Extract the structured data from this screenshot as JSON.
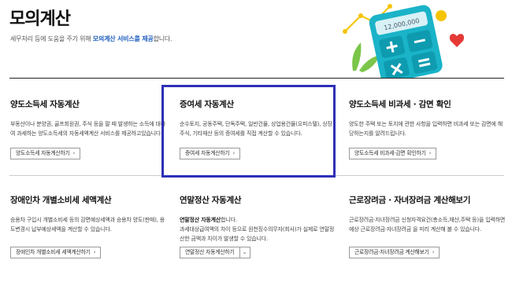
{
  "header": {
    "title": "모의계산",
    "subtitle_prefix": "세무처리 등에 도움을 주기 위해 ",
    "subtitle_highlight": "모의계산 서비스를 제공",
    "subtitle_suffix": "합니다.",
    "illustration_display": "12,000,000"
  },
  "cards": [
    {
      "title": "양도소득세 자동계산",
      "desc": "부동산이나 분양권, 골프회원권, 주식 등을 팔 때 발생하는 소득에 대하여 과세하는 양도소득세의 자동세액계산 서비스를 제공하고있습니다.",
      "button": "양도소득세 자동계산하기"
    },
    {
      "title": "증여세 자동계산",
      "desc": "순수토지, 공동주택, 단독주택, 일반건물, 상업용건물(오피스텔), 상장주식, 기타재산 등의 증여세를 직접 계산할 수 있습니다.",
      "button": "증여세 자동계산하기"
    },
    {
      "title": "양도소득세 비과세 · 감면 확인",
      "desc": "양도한 주택 또는 토지에 관한 사항을 입력하면 비과세 또는 감면에 해당하는지를 알려드립니다.",
      "button": "양도소득세 비과세·감면 확인하기"
    },
    {
      "title": "장애인차 개별소비세 세액계산",
      "desc": "승용차 구입시 개별소비세 등의 감면예상세액과 승용차 양도(판매), 용도변경시 납부예상세액을 계산할 수 있습니다.",
      "button": "장애인차 개별소비세 세액계산하기"
    },
    {
      "title": "연말정산 자동계산",
      "desc_strong": "연말정산 자동계산",
      "desc_rest": "합니다.",
      "desc2": "과세대상급여액의 차이 등으로 원천징수의무자(회사)가 실제로 연말정산한 금액과 차이가 발생할 수 있습니다.",
      "select": "연말정산 자동계산하기"
    },
    {
      "title": "근로장려금 · 자녀장려금 계산해보기",
      "desc": "근로장려금·자녀장려금 신청자격요건(총소득,재산,주택 등)을 입력하면 예상 근로장려금·자녀장려금 을 미리 계산해 볼 수 있습니다.",
      "button": "근로장려금·자녀장려금 계산해보기"
    }
  ],
  "colors": {
    "highlight_border": "#2e2fb7",
    "subtitle_accent": "#1f5fbf"
  }
}
